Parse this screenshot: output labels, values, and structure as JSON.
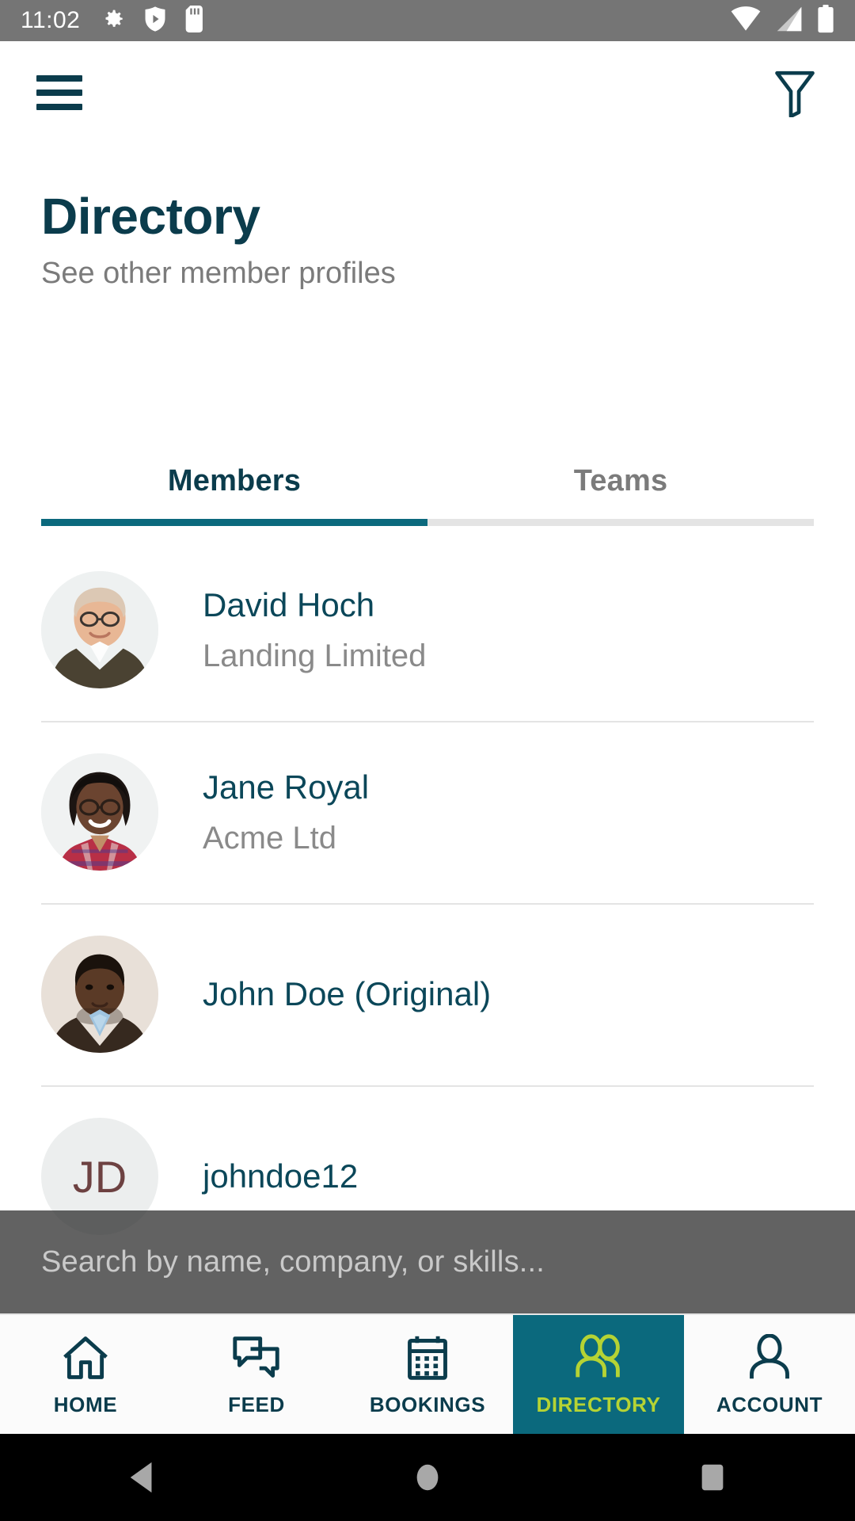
{
  "status_bar": {
    "time": "11:02",
    "left_icons": [
      "gear-icon",
      "shield-play-icon",
      "sd-card-icon"
    ],
    "right_icons": [
      "wifi-icon",
      "cellular-signal-icon",
      "battery-icon"
    ],
    "background": "#757575"
  },
  "app_bar": {
    "menu_icon": "hamburger-menu-icon",
    "filter_icon": "filter-funnel-icon",
    "icon_color": "#0b3c4c"
  },
  "header": {
    "title": "Directory",
    "subtitle": "See other member profiles",
    "title_color": "#0b3c4c",
    "subtitle_color": "#7b7b7b"
  },
  "tabs": {
    "active_index": 0,
    "indicator_color": "#0b697d",
    "items": [
      {
        "label": "Members"
      },
      {
        "label": "Teams"
      }
    ]
  },
  "members": [
    {
      "name": "David Hoch",
      "company": "Landing Limited",
      "avatar": "photo-man-glasses"
    },
    {
      "name": "Jane Royal",
      "company": "Acme Ltd",
      "avatar": "photo-woman-glasses"
    },
    {
      "name": "John Doe (Original)",
      "company": "",
      "avatar": "photo-man-suit"
    },
    {
      "name": "johndoe12",
      "company": "",
      "avatar": "initials-jd",
      "initials": "JD"
    }
  ],
  "search": {
    "placeholder": "Search by name, company, or skills...",
    "value": "",
    "icon": "search-input"
  },
  "bottom_nav": {
    "active_index": 3,
    "active_bg": "#0b697d",
    "active_fg": "#b5d334",
    "inactive_fg": "#0b3c4c",
    "items": [
      {
        "label": "HOME",
        "icon": "home-icon"
      },
      {
        "label": "FEED",
        "icon": "chat-bubbles-icon"
      },
      {
        "label": "BOOKINGS",
        "icon": "calendar-icon"
      },
      {
        "label": "DIRECTORY",
        "icon": "people-icon"
      },
      {
        "label": "ACCOUNT",
        "icon": "person-icon"
      }
    ]
  },
  "android_nav": {
    "back": "back-triangle-icon",
    "home": "home-circle-icon",
    "recents": "recents-square-icon"
  }
}
